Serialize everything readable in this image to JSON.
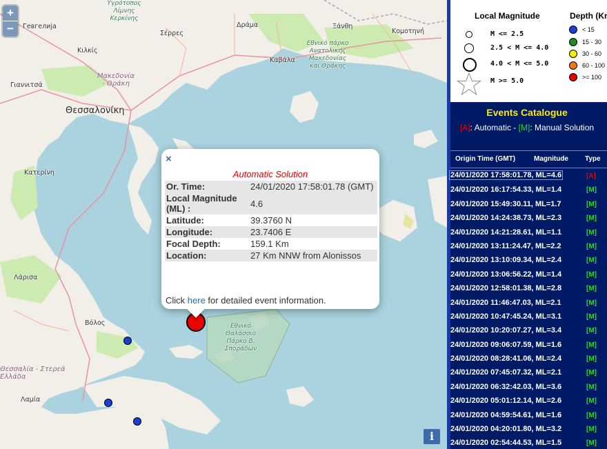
{
  "map": {
    "zoom_in": "+",
    "zoom_out": "−",
    "info_button": "i",
    "labels": [
      {
        "id": "gevgelija",
        "text": "Гевгелија"
      },
      {
        "id": "kilkis",
        "text": "Κιλκίς"
      },
      {
        "id": "serres",
        "text": "Σέρρες"
      },
      {
        "id": "drama",
        "text": "Δράμα"
      },
      {
        "id": "xanthi",
        "text": "Ξάνθη"
      },
      {
        "id": "komotini",
        "text": "Κομοτηνή"
      },
      {
        "id": "kavala",
        "text": "Καβάλα"
      },
      {
        "id": "giannitsa",
        "text": "Γιαννιτσά"
      },
      {
        "id": "thessaloniki",
        "text": "Θεσσαλονίκη"
      },
      {
        "id": "katerini",
        "text": "Κατερίνη"
      },
      {
        "id": "larisa",
        "text": "Λάρισα"
      },
      {
        "id": "volos",
        "text": "Βόλος"
      },
      {
        "id": "lamia",
        "text": "Λαμία"
      },
      {
        "id": "kerkini",
        "text": "Υγρότοπος Λίμνης Κερκίνης"
      },
      {
        "id": "park_amth",
        "text": "Εθνικό πάρκο Ανατολικής Μακεδονίας και Θράκης"
      },
      {
        "id": "sporades_park",
        "text": "Εθνικό Θαλάσσιο Πάρκο Β. Σποράδων"
      }
    ],
    "regions": [
      {
        "id": "mak_thr",
        "text": "Μακεδονία - Θράκη"
      },
      {
        "id": "thess_ster",
        "text": "Θεσσαλία - Στερεά Ελλάδα"
      }
    ],
    "events_colors": {
      "shallow": "#1a3fd4",
      "deep": "#e00000"
    }
  },
  "popup": {
    "close": "×",
    "title": "Automatic Solution",
    "rows": [
      {
        "k": "Or. Time:",
        "v": "24/01/2020 17:58:01.78 (GMT)"
      },
      {
        "k": "Local Magnitude (ML) :",
        "v": "4.6"
      },
      {
        "k": "Latitude:",
        "v": "39.3760 N"
      },
      {
        "k": "Longitude:",
        "v": "23.7406 E"
      },
      {
        "k": "Focal Depth:",
        "v": "159.1 Km"
      },
      {
        "k": "Location:",
        "v": "27 Km NNW from Alonissos"
      }
    ],
    "footer_pre": "Click ",
    "footer_link": "here",
    "footer_post": " for detailed event information."
  },
  "legend": {
    "magnitude_title": "Local Magnitude",
    "magnitude_rows": [
      "M <= 2.5",
      "2.5 < M <= 4.0",
      "4.0 < M <= 5.0",
      "M >= 5.0"
    ],
    "depth_title": "Depth (Km)",
    "depth_rows": [
      {
        "label": "< 15",
        "color": "#1a3fd4"
      },
      {
        "label": "15 - 30",
        "color": "#1e8c1e"
      },
      {
        "label": "30 - 60",
        "color": "#f0f000"
      },
      {
        "label": "60 - 100",
        "color": "#f07818"
      },
      {
        "label": ">= 100",
        "color": "#e00000"
      }
    ]
  },
  "catalogue": {
    "title": "Events Catalogue",
    "sub_a": "[A]",
    "sub_a_text": ": Automatic - ",
    "sub_m": "[M]",
    "sub_m_text": ": Manual Solution",
    "col_time": "Origin Time (GMT)",
    "col_mag": "Magnitude",
    "col_type": "Type",
    "events": [
      {
        "text": "24/01/2020 17:58:01.78, ML=4.6",
        "type": "[A]"
      },
      {
        "text": "24/01/2020 16:17:54.33, ML=1.4",
        "type": "[M]"
      },
      {
        "text": "24/01/2020 15:49:30.11, ML=1.7",
        "type": "[M]"
      },
      {
        "text": "24/01/2020 14:24:38.73, ML=2.3",
        "type": "[M]"
      },
      {
        "text": "24/01/2020 14:21:28.61, ML=1.1",
        "type": "[M]"
      },
      {
        "text": "24/01/2020 13:11:24.47, ML=2.2",
        "type": "[M]"
      },
      {
        "text": "24/01/2020 13:10:09.34, ML=2.4",
        "type": "[M]"
      },
      {
        "text": "24/01/2020 13:06:56.22, ML=1.4",
        "type": "[M]"
      },
      {
        "text": "24/01/2020 12:58:01.38, ML=2.8",
        "type": "[M]"
      },
      {
        "text": "24/01/2020 11:46:47.03, ML=2.1",
        "type": "[M]"
      },
      {
        "text": "24/01/2020 10:47:45.24, ML=3.1",
        "type": "[M]"
      },
      {
        "text": "24/01/2020 10:20:07.27, ML=3.4",
        "type": "[M]"
      },
      {
        "text": "24/01/2020 09:06:07.59, ML=1.6",
        "type": "[M]"
      },
      {
        "text": "24/01/2020 08:28:41.06, ML=2.4",
        "type": "[M]"
      },
      {
        "text": "24/01/2020 07:45:07.32, ML=2.1",
        "type": "[M]"
      },
      {
        "text": "24/01/2020 06:32:42.03, ML=3.6",
        "type": "[M]"
      },
      {
        "text": "24/01/2020 05:01:12.14, ML=2.6",
        "type": "[M]"
      },
      {
        "text": "24/01/2020 04:59:54.61, ML=1.6",
        "type": "[M]"
      },
      {
        "text": "24/01/2020 04:20:01.80, ML=3.2",
        "type": "[M]"
      },
      {
        "text": "24/01/2020 02:54:44.53, ML=1.5",
        "type": "[M]"
      }
    ]
  }
}
